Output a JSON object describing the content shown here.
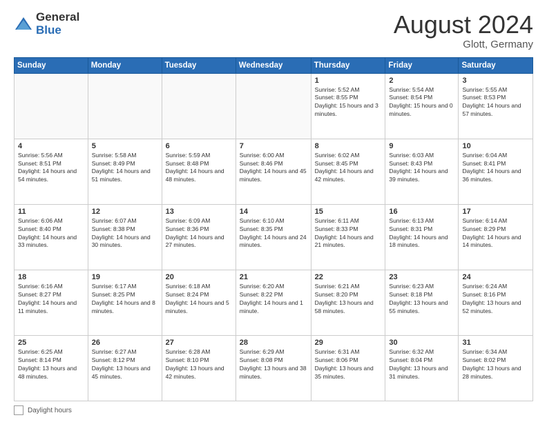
{
  "header": {
    "logo_general": "General",
    "logo_blue": "Blue",
    "month_year": "August 2024",
    "location": "Glott, Germany"
  },
  "calendar": {
    "days_of_week": [
      "Sunday",
      "Monday",
      "Tuesday",
      "Wednesday",
      "Thursday",
      "Friday",
      "Saturday"
    ],
    "weeks": [
      [
        {
          "day": "",
          "sunrise": "",
          "sunset": "",
          "daylight": "",
          "empty": true
        },
        {
          "day": "",
          "sunrise": "",
          "sunset": "",
          "daylight": "",
          "empty": true
        },
        {
          "day": "",
          "sunrise": "",
          "sunset": "",
          "daylight": "",
          "empty": true
        },
        {
          "day": "",
          "sunrise": "",
          "sunset": "",
          "daylight": "",
          "empty": true
        },
        {
          "day": "1",
          "sunrise": "Sunrise: 5:52 AM",
          "sunset": "Sunset: 8:55 PM",
          "daylight": "Daylight: 15 hours and 3 minutes.",
          "empty": false
        },
        {
          "day": "2",
          "sunrise": "Sunrise: 5:54 AM",
          "sunset": "Sunset: 8:54 PM",
          "daylight": "Daylight: 15 hours and 0 minutes.",
          "empty": false
        },
        {
          "day": "3",
          "sunrise": "Sunrise: 5:55 AM",
          "sunset": "Sunset: 8:53 PM",
          "daylight": "Daylight: 14 hours and 57 minutes.",
          "empty": false
        }
      ],
      [
        {
          "day": "4",
          "sunrise": "Sunrise: 5:56 AM",
          "sunset": "Sunset: 8:51 PM",
          "daylight": "Daylight: 14 hours and 54 minutes.",
          "empty": false
        },
        {
          "day": "5",
          "sunrise": "Sunrise: 5:58 AM",
          "sunset": "Sunset: 8:49 PM",
          "daylight": "Daylight: 14 hours and 51 minutes.",
          "empty": false
        },
        {
          "day": "6",
          "sunrise": "Sunrise: 5:59 AM",
          "sunset": "Sunset: 8:48 PM",
          "daylight": "Daylight: 14 hours and 48 minutes.",
          "empty": false
        },
        {
          "day": "7",
          "sunrise": "Sunrise: 6:00 AM",
          "sunset": "Sunset: 8:46 PM",
          "daylight": "Daylight: 14 hours and 45 minutes.",
          "empty": false
        },
        {
          "day": "8",
          "sunrise": "Sunrise: 6:02 AM",
          "sunset": "Sunset: 8:45 PM",
          "daylight": "Daylight: 14 hours and 42 minutes.",
          "empty": false
        },
        {
          "day": "9",
          "sunrise": "Sunrise: 6:03 AM",
          "sunset": "Sunset: 8:43 PM",
          "daylight": "Daylight: 14 hours and 39 minutes.",
          "empty": false
        },
        {
          "day": "10",
          "sunrise": "Sunrise: 6:04 AM",
          "sunset": "Sunset: 8:41 PM",
          "daylight": "Daylight: 14 hours and 36 minutes.",
          "empty": false
        }
      ],
      [
        {
          "day": "11",
          "sunrise": "Sunrise: 6:06 AM",
          "sunset": "Sunset: 8:40 PM",
          "daylight": "Daylight: 14 hours and 33 minutes.",
          "empty": false
        },
        {
          "day": "12",
          "sunrise": "Sunrise: 6:07 AM",
          "sunset": "Sunset: 8:38 PM",
          "daylight": "Daylight: 14 hours and 30 minutes.",
          "empty": false
        },
        {
          "day": "13",
          "sunrise": "Sunrise: 6:09 AM",
          "sunset": "Sunset: 8:36 PM",
          "daylight": "Daylight: 14 hours and 27 minutes.",
          "empty": false
        },
        {
          "day": "14",
          "sunrise": "Sunrise: 6:10 AM",
          "sunset": "Sunset: 8:35 PM",
          "daylight": "Daylight: 14 hours and 24 minutes.",
          "empty": false
        },
        {
          "day": "15",
          "sunrise": "Sunrise: 6:11 AM",
          "sunset": "Sunset: 8:33 PM",
          "daylight": "Daylight: 14 hours and 21 minutes.",
          "empty": false
        },
        {
          "day": "16",
          "sunrise": "Sunrise: 6:13 AM",
          "sunset": "Sunset: 8:31 PM",
          "daylight": "Daylight: 14 hours and 18 minutes.",
          "empty": false
        },
        {
          "day": "17",
          "sunrise": "Sunrise: 6:14 AM",
          "sunset": "Sunset: 8:29 PM",
          "daylight": "Daylight: 14 hours and 14 minutes.",
          "empty": false
        }
      ],
      [
        {
          "day": "18",
          "sunrise": "Sunrise: 6:16 AM",
          "sunset": "Sunset: 8:27 PM",
          "daylight": "Daylight: 14 hours and 11 minutes.",
          "empty": false
        },
        {
          "day": "19",
          "sunrise": "Sunrise: 6:17 AM",
          "sunset": "Sunset: 8:25 PM",
          "daylight": "Daylight: 14 hours and 8 minutes.",
          "empty": false
        },
        {
          "day": "20",
          "sunrise": "Sunrise: 6:18 AM",
          "sunset": "Sunset: 8:24 PM",
          "daylight": "Daylight: 14 hours and 5 minutes.",
          "empty": false
        },
        {
          "day": "21",
          "sunrise": "Sunrise: 6:20 AM",
          "sunset": "Sunset: 8:22 PM",
          "daylight": "Daylight: 14 hours and 1 minute.",
          "empty": false
        },
        {
          "day": "22",
          "sunrise": "Sunrise: 6:21 AM",
          "sunset": "Sunset: 8:20 PM",
          "daylight": "Daylight: 13 hours and 58 minutes.",
          "empty": false
        },
        {
          "day": "23",
          "sunrise": "Sunrise: 6:23 AM",
          "sunset": "Sunset: 8:18 PM",
          "daylight": "Daylight: 13 hours and 55 minutes.",
          "empty": false
        },
        {
          "day": "24",
          "sunrise": "Sunrise: 6:24 AM",
          "sunset": "Sunset: 8:16 PM",
          "daylight": "Daylight: 13 hours and 52 minutes.",
          "empty": false
        }
      ],
      [
        {
          "day": "25",
          "sunrise": "Sunrise: 6:25 AM",
          "sunset": "Sunset: 8:14 PM",
          "daylight": "Daylight: 13 hours and 48 minutes.",
          "empty": false
        },
        {
          "day": "26",
          "sunrise": "Sunrise: 6:27 AM",
          "sunset": "Sunset: 8:12 PM",
          "daylight": "Daylight: 13 hours and 45 minutes.",
          "empty": false
        },
        {
          "day": "27",
          "sunrise": "Sunrise: 6:28 AM",
          "sunset": "Sunset: 8:10 PM",
          "daylight": "Daylight: 13 hours and 42 minutes.",
          "empty": false
        },
        {
          "day": "28",
          "sunrise": "Sunrise: 6:29 AM",
          "sunset": "Sunset: 8:08 PM",
          "daylight": "Daylight: 13 hours and 38 minutes.",
          "empty": false
        },
        {
          "day": "29",
          "sunrise": "Sunrise: 6:31 AM",
          "sunset": "Sunset: 8:06 PM",
          "daylight": "Daylight: 13 hours and 35 minutes.",
          "empty": false
        },
        {
          "day": "30",
          "sunrise": "Sunrise: 6:32 AM",
          "sunset": "Sunset: 8:04 PM",
          "daylight": "Daylight: 13 hours and 31 minutes.",
          "empty": false
        },
        {
          "day": "31",
          "sunrise": "Sunrise: 6:34 AM",
          "sunset": "Sunset: 8:02 PM",
          "daylight": "Daylight: 13 hours and 28 minutes.",
          "empty": false
        }
      ]
    ]
  },
  "footer": {
    "label": "Daylight hours"
  }
}
